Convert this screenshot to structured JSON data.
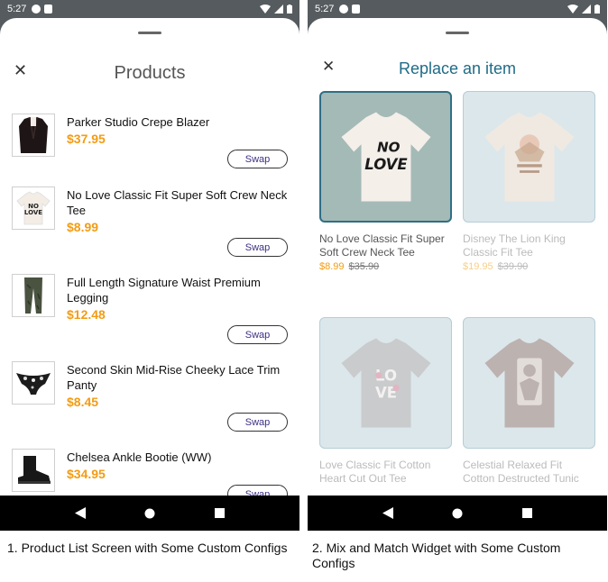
{
  "left_phone": {
    "status_time": "5:27",
    "title": "Products",
    "products": [
      {
        "name": "Parker Studio Crepe Blazer",
        "price": "$37.95",
        "swap": "Swap",
        "icon": "blazer-icon"
      },
      {
        "name": "No Love Classic Fit Super Soft Crew Neck Tee",
        "price": "$8.99",
        "swap": "Swap",
        "icon": "tshirt-icon"
      },
      {
        "name": "Full Length Signature Waist Premium Legging",
        "price": "$12.48",
        "swap": "Swap",
        "icon": "legging-icon"
      },
      {
        "name": "Second Skin Mid-Rise Cheeky Lace Trim Panty",
        "price": "$8.45",
        "swap": "Swap",
        "icon": "panty-icon"
      },
      {
        "name": "Chelsea Ankle Bootie (WW)",
        "price": "$34.95",
        "swap": "Swap",
        "icon": "bootie-icon"
      }
    ]
  },
  "right_phone": {
    "status_time": "5:27",
    "title": "Replace an item",
    "items": [
      {
        "title": "No Love Classic Fit Super Soft Crew Neck Tee",
        "sale_price": "$8.99",
        "orig_price": "$35.90",
        "selected": true,
        "icon": "tshirt-icon"
      },
      {
        "title": "Disney The Lion King Classic Fit Tee",
        "sale_price": "$19.95",
        "orig_price": "$39.90",
        "selected": false,
        "icon": "tshirt-icon"
      },
      {
        "title": "Love Classic Fit Cotton Heart Cut Out Tee",
        "selected": false,
        "icon": "tshirt-icon"
      },
      {
        "title": "Celestial Relaxed Fit Cotton Destructed Tunic",
        "selected": false,
        "icon": "tshirt-icon"
      }
    ]
  },
  "captions": {
    "left": "1. Product List Screen with Some Custom Configs",
    "right": "2. Mix and Match Widget with Some Custom Configs"
  },
  "colors": {
    "price": "#f39c12",
    "swap_text": "#3b2f83",
    "title_accent": "#1f6b87",
    "selected_border": "#2f6e85"
  }
}
